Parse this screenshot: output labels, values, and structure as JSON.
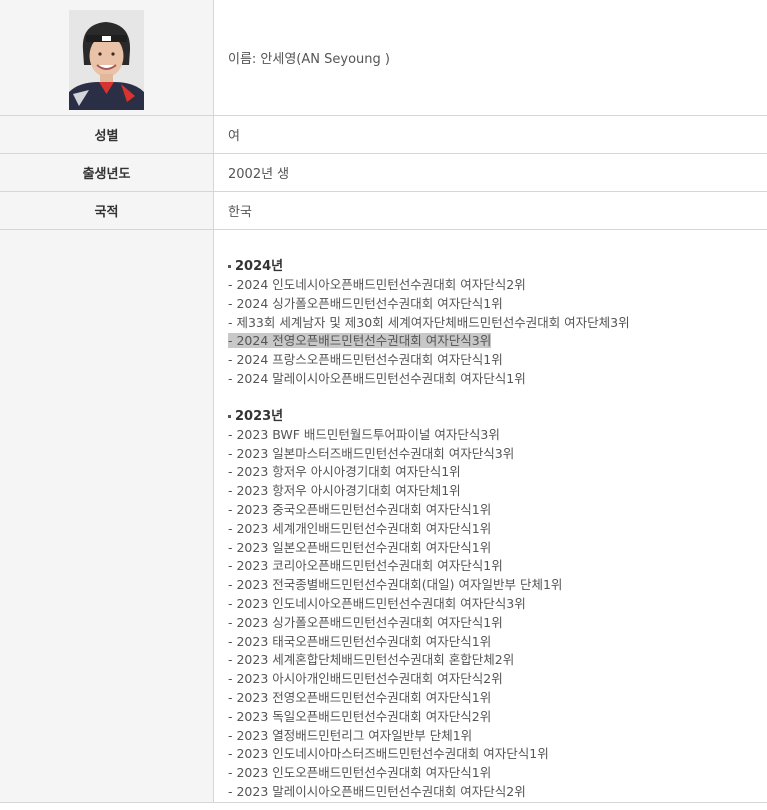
{
  "profile": {
    "name_value": "이름: 안세영(AN Seyoung )"
  },
  "rows": {
    "gender": {
      "label": "성별",
      "value": "여"
    },
    "birth": {
      "label": "출생년도",
      "value": "2002년 생"
    },
    "nationality": {
      "label": "국적",
      "value": "한국"
    }
  },
  "awards": {
    "y2024": {
      "title": "2024년",
      "items": [
        "- 2024 인도네시아오픈배드민턴선수권대회 여자단식2위",
        "- 2024 싱가폴오픈배드민턴선수권대회 여자단식1위",
        "- 제33회 세계남자 및 제30회 세계여자단체배드민턴선수권대회 여자단체3위",
        "- 2024 전영오픈배드민턴선수권대회 여자단식3위",
        "- 2024 프랑스오픈배드민턴선수권대회 여자단식1위",
        "- 2024 말레이시아오픈배드민턴선수권대회 여자단식1위"
      ]
    },
    "y2023": {
      "title": "2023년",
      "items": [
        "- 2023 BWF 배드민턴월드투어파이널 여자단식3위",
        "- 2023 일본마스터즈배드민턴선수권대회 여자단식3위",
        "- 2023 항저우 아시아경기대회 여자단식1위",
        "- 2023 항저우 아시아경기대회 여자단체1위",
        "- 2023 중국오픈배드민턴선수권대회 여자단식1위",
        "- 2023 세계개인배드민턴선수권대회 여자단식1위",
        "- 2023 일본오픈배드민턴선수권대회 여자단식1위",
        "- 2023 코리아오픈배드민턴선수권대회 여자단식1위",
        "- 2023 전국종별배드민턴선수권대회(대일) 여자일반부 단체1위",
        "- 2023 인도네시아오픈배드민턴선수권대회 여자단식3위",
        "- 2023 싱가폴오픈배드민턴선수권대회 여자단식1위",
        "- 2023 태국오픈배드민턴선수권대회 여자단식1위",
        "- 2023 세계혼합단체배드민턴선수권대회 혼합단체2위",
        "- 2023 아시아개인배드민턴선수권대회 여자단식2위",
        "- 2023 전영오픈배드민턴선수권대회 여자단식1위",
        "- 2023 독일오픈배드민턴선수권대회 여자단식2위",
        "- 2023 열정배드민턴리그 여자일반부 단체1위",
        "- 2023 인도네시아마스터즈배드민턴선수권대회 여자단식1위",
        "- 2023 인도오픈배드민턴선수권대회 여자단식1위",
        "- 2023 말레이시아오픈배드민턴선수권대회 여자단식2위"
      ]
    }
  },
  "colors": {
    "header_bg": "#f5f5f5",
    "border": "#d6d6d6",
    "highlight": "#c8c8c8"
  }
}
